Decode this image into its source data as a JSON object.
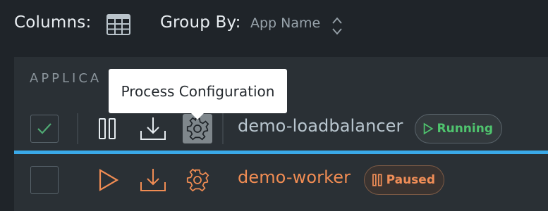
{
  "toolbar": {
    "columns_label": "Columns:",
    "group_by_label": "Group By:",
    "group_by_value": "App Name"
  },
  "table": {
    "column_header": "APPLICA"
  },
  "tooltip": {
    "text": "Process Configuration"
  },
  "rows": [
    {
      "checked": true,
      "name": "demo-loadbalancer",
      "status": "Running",
      "status_color": "#4fc46e"
    },
    {
      "checked": false,
      "name": "demo-worker",
      "status": "Paused",
      "status_color": "#ef8d57"
    }
  ],
  "colors": {
    "background": "#1f2429",
    "panel": "#2a3035",
    "selection_line": "#3aa9e8",
    "running": "#4fc46e",
    "paused": "#f08c53"
  }
}
